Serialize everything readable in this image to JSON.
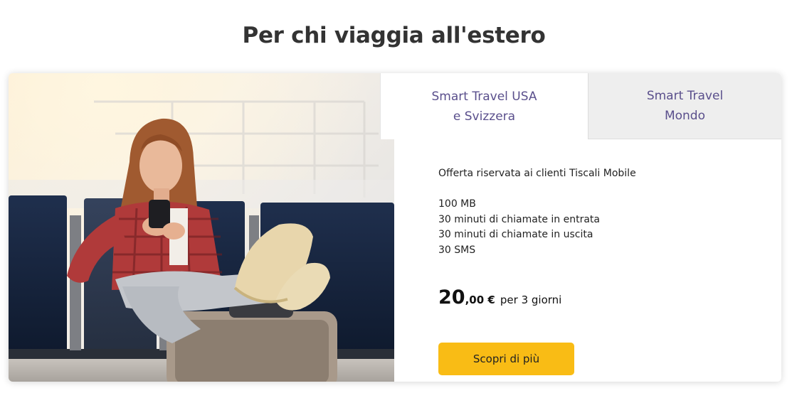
{
  "section": {
    "title": "Per chi viaggia all'estero"
  },
  "tabs": [
    {
      "label": "Smart Travel USA\ne Svizzera",
      "active": true
    },
    {
      "label": "Smart Travel\nMondo",
      "active": false
    }
  ],
  "offer": {
    "intro": "Offerta riservata ai clienti Tiscali Mobile",
    "features": [
      "100 MB",
      "30 minuti di chiamate in entrata",
      "30 minuti di chiamate in uscita",
      "30 SMS"
    ],
    "price": {
      "integer": "20",
      "decimal": ",00 €",
      "period": "per 3 giorni"
    },
    "cta_label": "Scopri di più"
  },
  "colors": {
    "title": "#333333",
    "tab_text": "#5a4f8c",
    "inactive_tab_bg": "#eeeeee",
    "cta_bg": "#f9bc15"
  }
}
